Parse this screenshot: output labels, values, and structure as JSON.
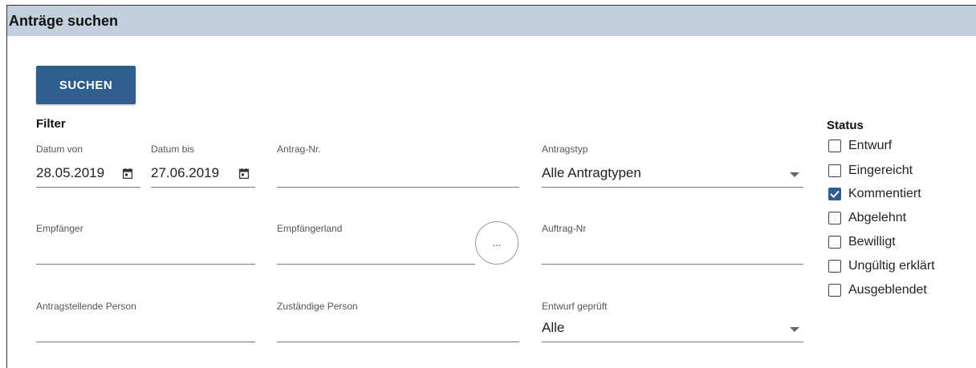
{
  "header": {
    "title": "Anträge suchen"
  },
  "search_button": {
    "label": "SUCHEN"
  },
  "filter": {
    "title": "Filter",
    "datum_von": {
      "label": "Datum von",
      "value": "28.05.2019"
    },
    "datum_bis": {
      "label": "Datum bis",
      "value": "27.06.2019"
    },
    "antrag_nr": {
      "label": "Antrag-Nr.",
      "value": ""
    },
    "antragstyp": {
      "label": "Antragstyp",
      "value": "Alle Antragtypen"
    },
    "empfaenger": {
      "label": "Empfänger",
      "value": ""
    },
    "empfaengerland": {
      "label": "Empfängerland",
      "value": "",
      "more_label": "..."
    },
    "auftrag_nr": {
      "label": "Auftrag-Nr",
      "value": ""
    },
    "antragstellende_person": {
      "label": "Antragstellende Person",
      "value": ""
    },
    "zustaendige_person": {
      "label": "Zuständige Person",
      "value": ""
    },
    "entwurf_geprueft": {
      "label": "Entwurf geprüft",
      "value": "Alle"
    }
  },
  "status": {
    "title": "Status",
    "items": [
      {
        "label": "Entwurf",
        "checked": false
      },
      {
        "label": "Eingereicht",
        "checked": false
      },
      {
        "label": "Kommentiert",
        "checked": true
      },
      {
        "label": "Abgelehnt",
        "checked": false
      },
      {
        "label": "Bewilligt",
        "checked": false
      },
      {
        "label": "Ungültig erklärt",
        "checked": false
      },
      {
        "label": "Ausgeblendet",
        "checked": false
      }
    ]
  },
  "colors": {
    "header_bg": "#c3cfdc",
    "primary": "#2e5e8c"
  }
}
